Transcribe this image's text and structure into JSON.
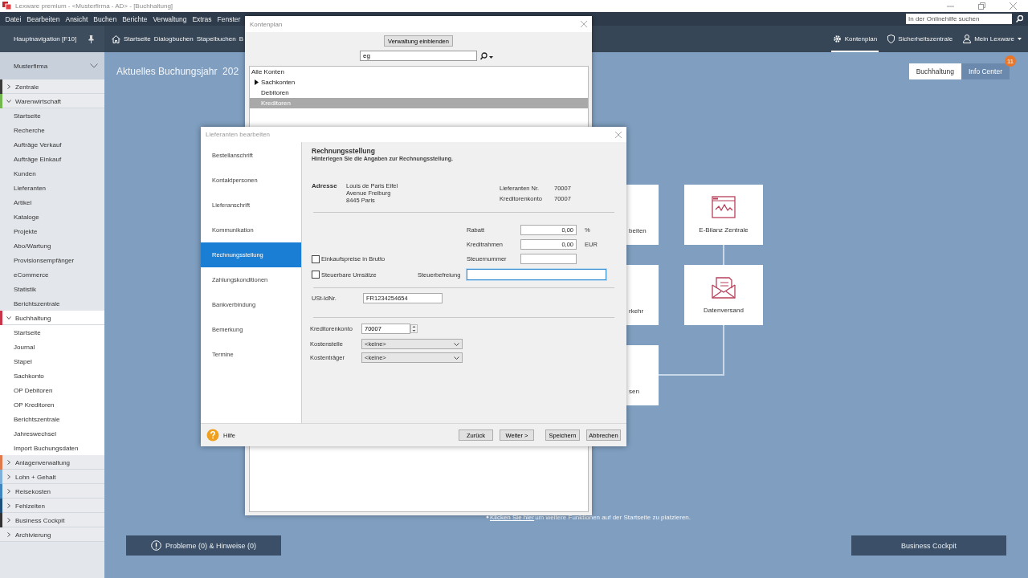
{
  "window": {
    "title": "Lexware premium - <Musterfirma - AD> - [Buchhaltung]"
  },
  "menu_bar": {
    "items": [
      "Datei",
      "Bearbeiten",
      "Ansicht",
      "Buchen",
      "Berichte",
      "Verwaltung",
      "Extras",
      "Fenster"
    ],
    "help_search": {
      "placeholder": "In der Onlinehilfe suchen"
    }
  },
  "nav_bar": {
    "title": "Hauptnavigation [F10]",
    "quick_links": [
      "Startseite",
      "Dialogbuchen",
      "Stapelbuchen",
      "B"
    ],
    "right_items": [
      {
        "label": "Kontenplan",
        "selected": true
      },
      {
        "label": "Sicherheitszentrale",
        "selected": false
      },
      {
        "label": "Mein Lexware",
        "selected": false
      }
    ]
  },
  "sidebar": {
    "company": "Musterfirma",
    "groups": [
      {
        "label": "Zentrale",
        "color": "#3b3b3b",
        "expanded": false,
        "selected": false
      },
      {
        "label": "Warenwirtschaft",
        "color": "#72b84e",
        "expanded": true,
        "selected": false,
        "children": [
          "Startseite",
          "Recherche",
          "Aufträge Verkauf",
          "Aufträge Einkauf",
          "Kunden",
          "Lieferanten",
          "Artikel",
          "Kataloge",
          "Projekte",
          "Abo/Wartung",
          "Provisionsempfänger",
          "eCommerce",
          "Statistik",
          "Berichtszentrale"
        ]
      },
      {
        "label": "Buchhaltung",
        "color": "#c8364a",
        "expanded": true,
        "selected": true,
        "children": [
          "Startseite",
          "Journal",
          "Stapel",
          "Sachkonto",
          "OP Debitoren",
          "OP Kreditoren",
          "Berichtszentrale",
          "Jahreswechsel",
          "Import Buchungsdaten"
        ]
      },
      {
        "label": "Anlagenverwaltung",
        "color": "#e07a4a",
        "expanded": false,
        "selected": false
      },
      {
        "label": "Lohn + Gehalt",
        "color": "#7fb0dc",
        "expanded": false,
        "selected": false
      },
      {
        "label": "Reisekosten",
        "color": "#3f86c0",
        "expanded": false,
        "selected": false
      },
      {
        "label": "Fehlzeiten",
        "color": "#1e4f7a",
        "expanded": false,
        "selected": false
      },
      {
        "label": "Business Cockpit",
        "color": "#333333",
        "expanded": false,
        "selected": false
      },
      {
        "label": "Archivierung",
        "expanded": false,
        "selected": false
      }
    ]
  },
  "main": {
    "heading": "Aktuelles Buchungsjahr  202",
    "view_tabs": [
      {
        "label": "Buchhaltung",
        "selected": true
      },
      {
        "label": "Info Center",
        "selected": false,
        "badge": "11"
      }
    ],
    "tiles": [
      {
        "label": "beiten"
      },
      {
        "label": "E-Bilanz Zentrale"
      },
      {
        "label": "rkehr"
      },
      {
        "label": "Datenversand"
      },
      {
        "label": "sen"
      }
    ],
    "hint": {
      "link": "Klicken Sie hier",
      "text": "um weitere Funktionen auf der Startseite zu platzieren."
    },
    "buttons": [
      "Probleme (0) & Hinweise (0)",
      "Business Cockpit"
    ]
  },
  "kontenplan": {
    "title": "Kontenplan",
    "button": "Verwaltung einblenden",
    "search": {
      "value": "eg"
    },
    "tree": [
      {
        "label": "Alle Konten",
        "selected": false,
        "children": [
          {
            "label": "Sachkonten",
            "expanded": false,
            "selected": false
          },
          {
            "label": "Debitoren",
            "selected": false
          },
          {
            "label": "Kreditoren",
            "selected": true
          }
        ]
      }
    ]
  },
  "lieferant": {
    "title": "Lieferanten bearbeiten",
    "sections": [
      {
        "label": "Bestellanschrift",
        "selected": false
      },
      {
        "label": "Kontaktpersonen",
        "selected": false
      },
      {
        "label": "Lieferanschrift",
        "selected": false
      },
      {
        "label": "Kommunikation",
        "selected": false
      },
      {
        "label": "Rechnungsstellung",
        "selected": true
      },
      {
        "label": "Zahlungskonditionen",
        "selected": false
      },
      {
        "label": "Bankverbindung",
        "selected": false
      },
      {
        "label": "Bemerkung",
        "selected": false
      },
      {
        "label": "Termine",
        "selected": false
      }
    ],
    "heading": "Rechnungsstellung",
    "subtitle": "Hinterlegen Sie die Angaben zur Rechnungsstellung.",
    "address": {
      "label": "Adresse",
      "lines": [
        "Louis de Paris Eifel",
        "Avenue Freiburg",
        "8445 Paris"
      ]
    },
    "info": [
      {
        "label": "Lieferanten Nr.",
        "value": "70007"
      },
      {
        "label": "Kreditorenkonto",
        "value": "70007"
      }
    ],
    "rabatt": {
      "label": "Rabatt",
      "value": "0,00",
      "unit": "%"
    },
    "kreditrahmen": {
      "label": "Kreditrahmen",
      "value": "0,00",
      "unit": "EUR"
    },
    "steuernummer": {
      "label": "Steuernummer"
    },
    "checkboxes": [
      {
        "label": "Einkaufspreise in Brutto",
        "checked": false
      },
      {
        "label": "Steuerbare Umsätze",
        "checked": false
      }
    ],
    "steuerbefreiung": {
      "label": "Steuerbefreiung",
      "focused": true
    },
    "ust": {
      "label": "USt-IdNr.",
      "value": "FR1234254654"
    },
    "kreditorenkonto": {
      "label": "Kreditorenkonto",
      "value": "70007"
    },
    "kostenstelle": {
      "label": "Kostenstelle",
      "value": "<keine>"
    },
    "kostentraeger": {
      "label": "Kostenträger",
      "value": "<keine>"
    },
    "help": "Hilfe",
    "buttons": [
      "Zurück",
      "Weiter >",
      "Speichern",
      "Abbrechen"
    ]
  }
}
